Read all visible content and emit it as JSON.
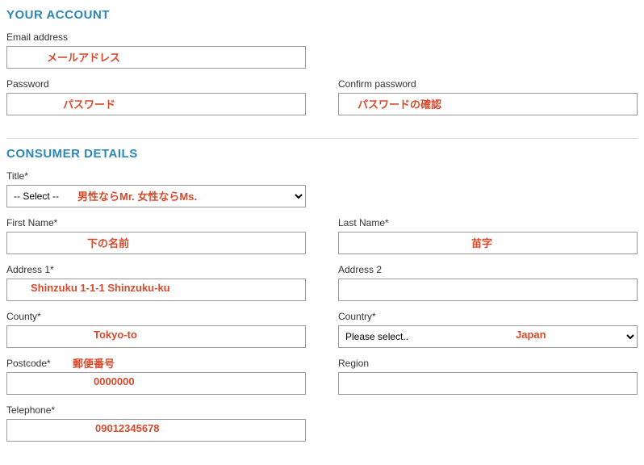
{
  "sections": {
    "account": {
      "heading": "YOUR ACCOUNT"
    },
    "consumer": {
      "heading": "CONSUMER DETAILS"
    }
  },
  "fields": {
    "email": {
      "label": "Email address",
      "annotation": "メールアドレス"
    },
    "password": {
      "label": "Password",
      "annotation": "パスワード"
    },
    "confirmPassword": {
      "label": "Confirm password",
      "annotation": "パスワードの確認"
    },
    "title": {
      "label": "Title*",
      "placeholder": "-- Select --",
      "annotation": "男性ならMr. 女性ならMs."
    },
    "firstName": {
      "label": "First Name*",
      "annotation": "下の名前"
    },
    "lastName": {
      "label": "Last Name*",
      "annotation": "苗字"
    },
    "address1": {
      "label": "Address 1*",
      "annotation": "Shinzuku 1-1-1 Shinzuku-ku"
    },
    "address2": {
      "label": "Address 2"
    },
    "county": {
      "label": "County*",
      "annotation": "Tokyo-to"
    },
    "country": {
      "label": "Country*",
      "placeholder": "Please select..",
      "annotation": "Japan"
    },
    "postcode": {
      "label": "Postcode*",
      "annotation1": "郵便番号",
      "annotation2": "0000000"
    },
    "region": {
      "label": "Region"
    },
    "telephone": {
      "label": "Telephone*",
      "annotation": "09012345678"
    }
  }
}
